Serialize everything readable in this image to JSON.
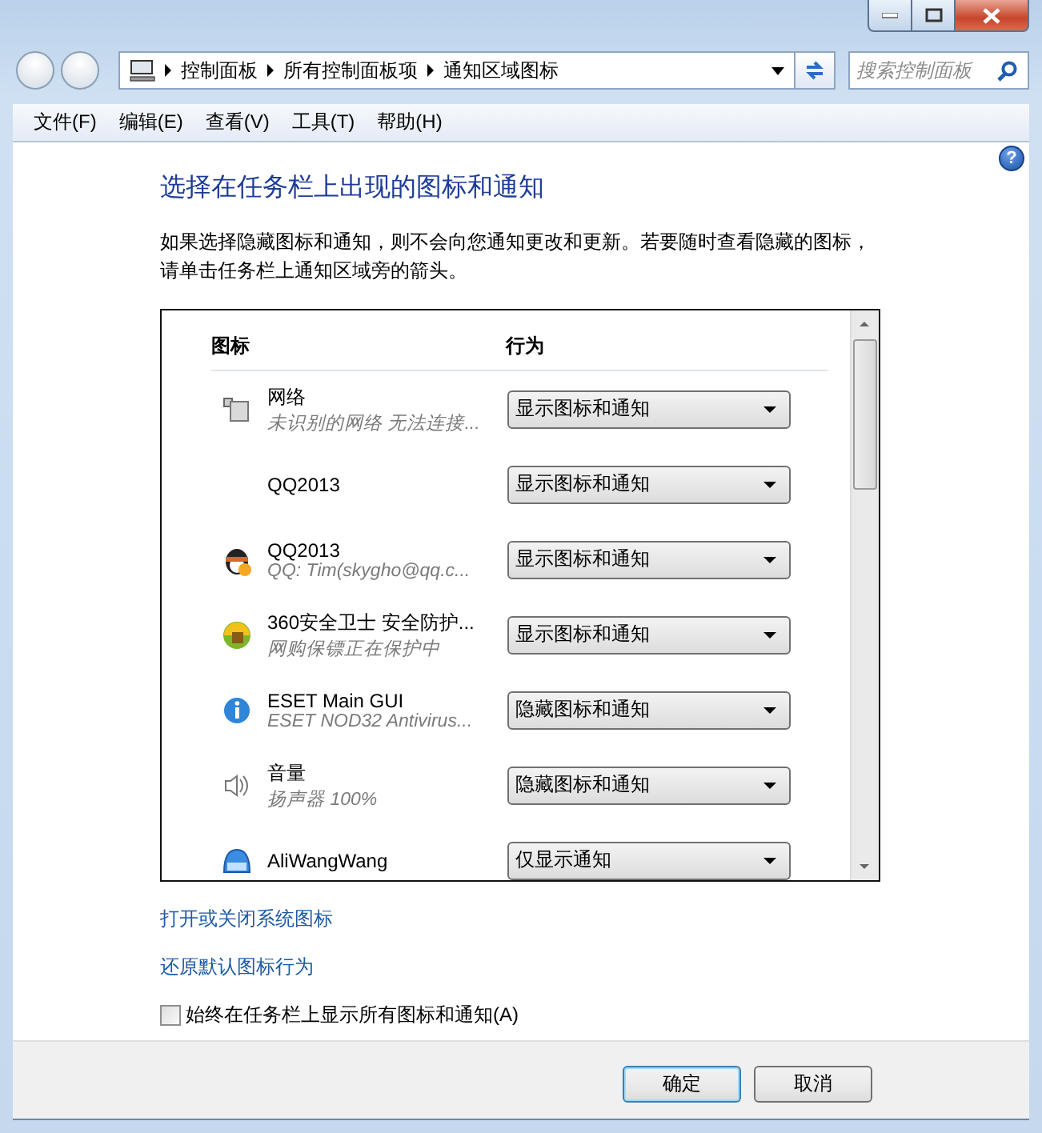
{
  "window": {
    "breadcrumbs": [
      "控制面板",
      "所有控制面板项",
      "通知区域图标"
    ],
    "search": {
      "placeholder": "搜索控制面板"
    }
  },
  "menu": [
    "文件(F)",
    "编辑(E)",
    "查看(V)",
    "工具(T)",
    "帮助(H)"
  ],
  "help": "?",
  "heading": "选择在任务栏上出现的图标和通知",
  "description": "如果选择隐藏图标和通知，则不会向您通知更改和更新。若要随时查看隐藏的图标，请单击任务栏上通知区域旁的箭头。",
  "table": {
    "columns": [
      "图标",
      "行为"
    ],
    "rows": [
      {
        "name": "网络",
        "detail": "未识别的网络 无法连接...",
        "behavior": "显示图标和通知"
      },
      {
        "name": "QQ2013",
        "behavior": "显示图标和通知"
      },
      {
        "name": "QQ2013",
        "detail": "QQ: Tim(skygho@qq.c...",
        "behavior": "显示图标和通知"
      },
      {
        "name": "360安全卫士 安全防护...",
        "detail": "网购保镖正在保护中",
        "behavior": "显示图标和通知"
      },
      {
        "name": "ESET Main GUI",
        "detail": "ESET NOD32 Antivirus...",
        "behavior": "隐藏图标和通知"
      },
      {
        "name": "音量",
        "detail": "扬声器 100%",
        "behavior": "隐藏图标和通知"
      },
      {
        "name": "AliWangWang",
        "behavior": "仅显示通知"
      }
    ]
  },
  "links": [
    "打开或关闭系统图标",
    "还原默认图标行为"
  ],
  "always_show": {
    "label": "始终在任务栏上显示所有图标和通知(A)",
    "checked": false
  },
  "buttons": [
    "确定",
    "取消"
  ]
}
